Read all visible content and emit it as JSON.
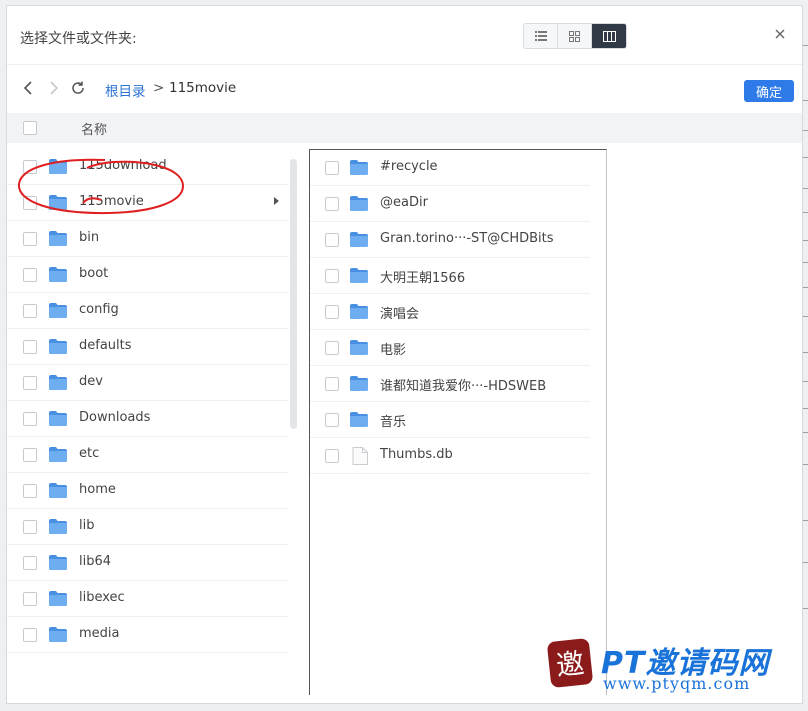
{
  "dialog": {
    "title": "选择文件或文件夹:",
    "view_modes": [
      {
        "name": "list-view",
        "icon": "list-icon",
        "active": false
      },
      {
        "name": "grid-view",
        "icon": "grid-icon",
        "active": false
      },
      {
        "name": "column-view",
        "icon": "columns-icon",
        "active": true
      }
    ],
    "close_icon": "close-icon"
  },
  "breadcrumb": {
    "root": "根目录",
    "separator": ">",
    "current": "115movie"
  },
  "toolbar": {
    "confirm_label": "确定"
  },
  "list_header": {
    "name_label": "名称"
  },
  "column1": [
    {
      "label": "115download",
      "type": "folder"
    },
    {
      "label": "115movie",
      "type": "folder",
      "expanded": true
    },
    {
      "label": "bin",
      "type": "folder"
    },
    {
      "label": "boot",
      "type": "folder"
    },
    {
      "label": "config",
      "type": "folder"
    },
    {
      "label": "defaults",
      "type": "folder"
    },
    {
      "label": "dev",
      "type": "folder"
    },
    {
      "label": "Downloads",
      "type": "folder"
    },
    {
      "label": "etc",
      "type": "folder"
    },
    {
      "label": "home",
      "type": "folder"
    },
    {
      "label": "lib",
      "type": "folder"
    },
    {
      "label": "lib64",
      "type": "folder"
    },
    {
      "label": "libexec",
      "type": "folder"
    },
    {
      "label": "media",
      "type": "folder"
    }
  ],
  "column2": [
    {
      "label": "#recycle",
      "type": "folder"
    },
    {
      "label": "@eaDir",
      "type": "folder"
    },
    {
      "label": "Gran.torino···-ST@CHDBits",
      "type": "folder"
    },
    {
      "label": "大明王朝1566",
      "type": "folder"
    },
    {
      "label": "演唱会",
      "type": "folder"
    },
    {
      "label": "电影",
      "type": "folder"
    },
    {
      "label": "谁都知道我爱你···-HDSWEB",
      "type": "folder"
    },
    {
      "label": "音乐",
      "type": "folder"
    },
    {
      "label": "Thumbs.db",
      "type": "file"
    }
  ],
  "watermark": {
    "badge": "邀",
    "title": "PT邀请码网",
    "url": "www.ptyqm.com"
  },
  "colors": {
    "accent": "#2d7ae8",
    "folder": "#5ea2ec",
    "annotation": "#e02020",
    "watermark": "#1a73d9"
  }
}
